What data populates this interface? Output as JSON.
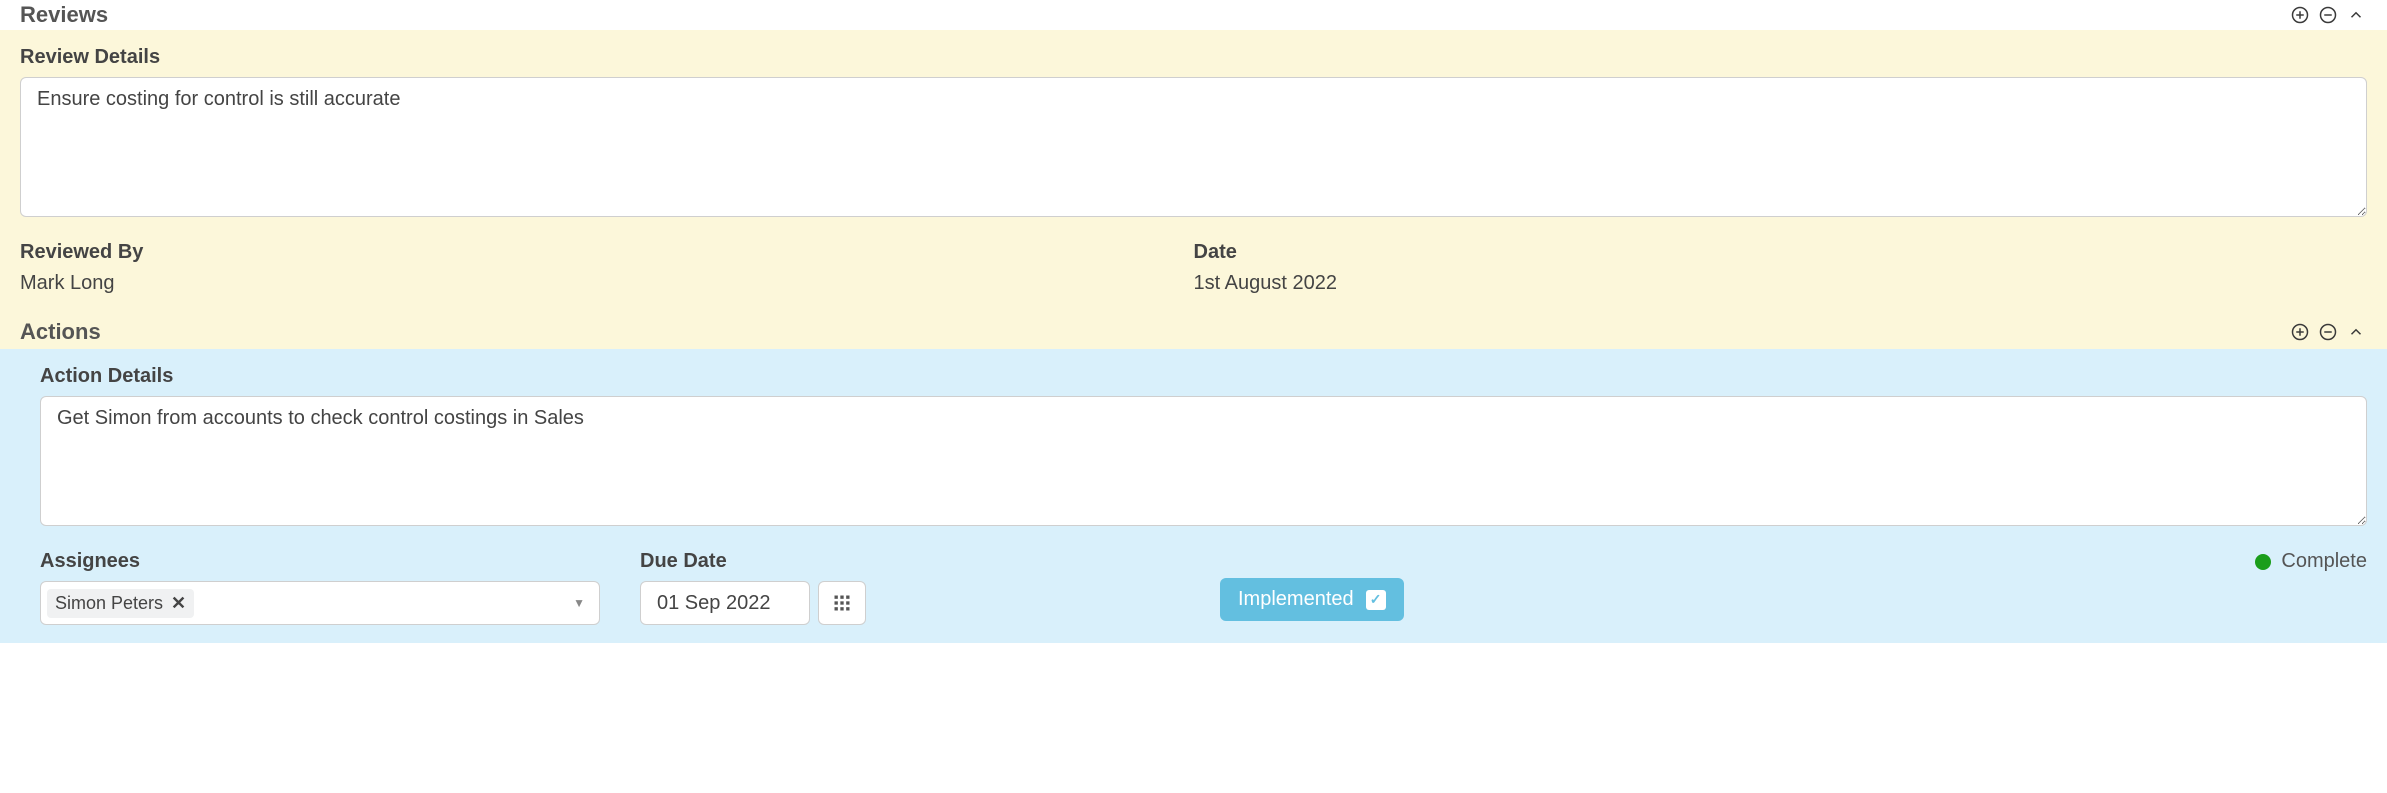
{
  "reviews": {
    "section_title": "Reviews",
    "details_label": "Review Details",
    "details_value": "Ensure costing for control is still accurate",
    "reviewed_by_label": "Reviewed By",
    "reviewed_by_value": "Mark Long",
    "date_label": "Date",
    "date_value": "1st August 2022"
  },
  "actions": {
    "section_title": "Actions",
    "details_label": "Action Details",
    "details_value": "Get Simon from accounts to check control costings in Sales",
    "assignees_label": "Assignees",
    "assignees": [
      "Simon Peters"
    ],
    "due_date_label": "Due Date",
    "due_date_value": "01 Sep 2022",
    "implemented_label": "Implemented",
    "implemented_checked": true,
    "complete_label": "Complete",
    "complete_status_color": "#1b9e1b"
  }
}
